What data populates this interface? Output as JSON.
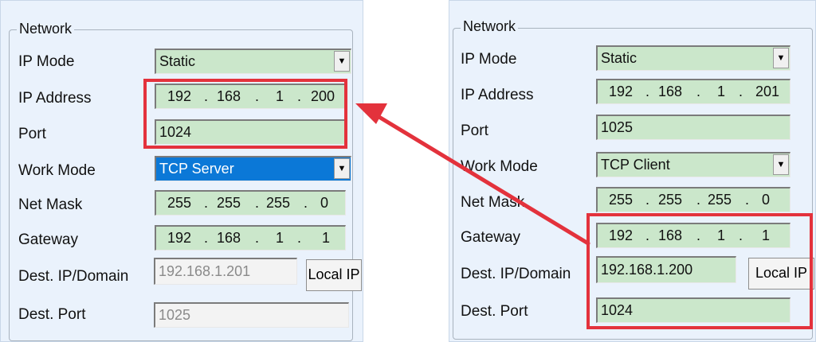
{
  "left": {
    "group_title": "Network",
    "ip_mode": {
      "label": "IP Mode",
      "value": "Static"
    },
    "ip_address": {
      "label": "IP Address",
      "octets": [
        "192",
        "168",
        "1",
        "200"
      ]
    },
    "port": {
      "label": "Port",
      "value": "1024"
    },
    "work_mode": {
      "label": "Work Mode",
      "value": "TCP Server"
    },
    "net_mask": {
      "label": "Net Mask",
      "octets": [
        "255",
        "255",
        "255",
        "0"
      ]
    },
    "gateway": {
      "label": "Gateway",
      "octets": [
        "192",
        "168",
        "1",
        "1"
      ]
    },
    "dest_ip": {
      "label": "Dest. IP/Domain",
      "value": "192.168.1.201"
    },
    "local_ip_button": "Local IP",
    "dest_port": {
      "label": "Dest. Port",
      "value": "1025"
    }
  },
  "right": {
    "group_title": "Network",
    "ip_mode": {
      "label": "IP Mode",
      "value": "Static"
    },
    "ip_address": {
      "label": "IP Address",
      "octets": [
        "192",
        "168",
        "1",
        "201"
      ]
    },
    "port": {
      "label": "Port",
      "value": "1025"
    },
    "work_mode": {
      "label": "Work Mode",
      "value": "TCP Client"
    },
    "net_mask": {
      "label": "Net Mask",
      "octets": [
        "255",
        "255",
        "255",
        "0"
      ]
    },
    "gateway": {
      "label": "Gateway",
      "octets": [
        "192",
        "168",
        "1",
        "1"
      ]
    },
    "dest_ip": {
      "label": "Dest. IP/Domain",
      "value": "192.168.1.200"
    },
    "local_ip_button": "Local IP",
    "dest_port": {
      "label": "Dest. Port",
      "value": "1024"
    }
  },
  "ip_separator": ".",
  "colors": {
    "panel_bg": "#eaf2fc",
    "field_bg": "#cbe7cb",
    "selected_bg": "#0b78d7",
    "highlight": "#e3323c"
  },
  "icons": {
    "dropdown": "chevron-down-icon",
    "annotation": "arrow-icon"
  }
}
